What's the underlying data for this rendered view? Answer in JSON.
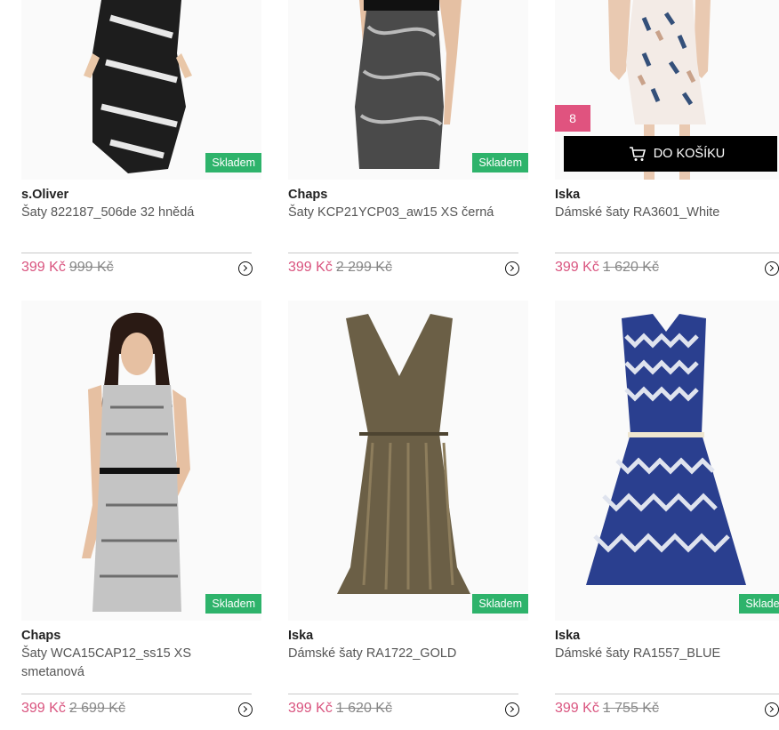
{
  "products": [
    {
      "brand": "s.Oliver",
      "name": "Šaty 822187_506de 32 hnědá",
      "price": "399 Kč",
      "old_price": "999 Kč",
      "stock": "Skladem"
    },
    {
      "brand": "Chaps",
      "name": "Šaty KCP21YCP03_aw15 XS černá",
      "price": "399 Kč",
      "old_price": "2 299 Kč",
      "stock": "Skladem"
    },
    {
      "brand": "Iska",
      "name": "Dámské šaty RA3601_White",
      "price": "399 Kč",
      "old_price": "1 620 Kč",
      "qty": "8",
      "cart_label": "DO KOŠÍKU"
    },
    {
      "brand": "Chaps",
      "name": "Šaty WCA15CAP12_ss15 XS smetanová",
      "price": "399 Kč",
      "old_price": "2 699 Kč",
      "stock": "Skladem"
    },
    {
      "brand": "Iska",
      "name": "Dámské šaty RA1722_GOLD",
      "price": "399 Kč",
      "old_price": "1 620 Kč",
      "stock": "Skladem"
    },
    {
      "brand": "Iska",
      "name": "Dámské šaty RA1557_BLUE",
      "price": "399 Kč",
      "old_price": "1 755 Kč",
      "stock": "Skladem"
    }
  ],
  "icons": {
    "product_link": "chevron-circle-right-icon",
    "cart": "cart-icon"
  },
  "colors": {
    "price": "#d9547f",
    "stock": "#2eb36b",
    "qty": "#e0537f",
    "cart": "#000000"
  }
}
